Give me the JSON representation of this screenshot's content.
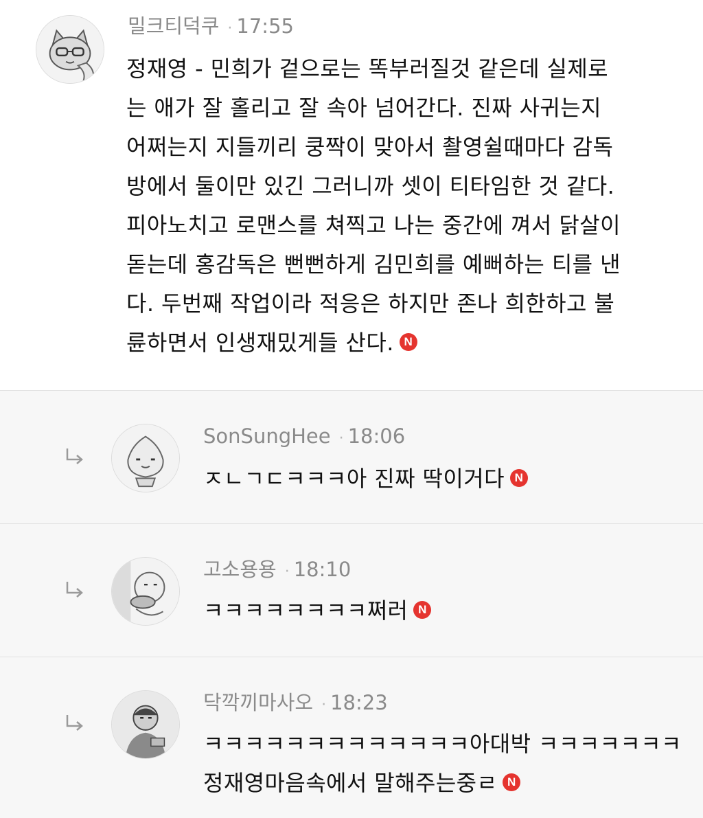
{
  "comments": [
    {
      "author": "밀크티덕쿠",
      "time": "17:55",
      "avatar_icon": "cat-character-avatar-icon",
      "lines": [
        "정재영 - 민희가 겉으로는 똑부러질것 같은데 실제로",
        "는 애가 잘 홀리고 잘 속아 넘어간다. 진짜 사귀는지",
        "어쩌는지 지들끼리 쿵짝이 맞아서 촬영쉴때마다 감독",
        "방에서 둘이만 있긴 그러니까 셋이 티타임한 것 같다.",
        "피아노치고 로맨스를 쳐찍고 나는 중간에 껴서 닭살이",
        "돋는데 홍감독은 뻔뻔하게 김민희를 예뻐하는 티를 낸",
        "다. 두번째 작업이라 적응은 하지만 존나 희한하고 불",
        "륜하면서 인생재밌게들 산다."
      ],
      "badge": "N"
    }
  ],
  "replies": [
    {
      "author": "SonSungHee",
      "time": "18:06",
      "avatar_icon": "peach-character-avatar-icon",
      "lines": [
        "ㅈㄴㄱㄷㅋㅋㅋ아 진짜 딱이거다"
      ],
      "badge": "N"
    },
    {
      "author": "고소용용",
      "time": "18:10",
      "avatar_icon": "eating-character-avatar-icon",
      "lines": [
        "ㅋㅋㅋㅋㅋㅋㅋㅋ쩌러"
      ],
      "badge": "N"
    },
    {
      "author": "닥깍끼마사오",
      "time": "18:23",
      "avatar_icon": "person-photo-avatar-icon",
      "lines": [
        "ㅋㅋㅋㅋㅋㅋㅋㅋㅋㅋㅋㅋㅋ아대박 ㅋㅋㅋㅋㅋㅋㅋ",
        "정재영마음속에서 말해주는중ㄹ"
      ],
      "badge": "N"
    }
  ],
  "colors": {
    "badge": "#e5342f",
    "meta_text": "#8a8a8a",
    "reply_bg": "#f7f7f7"
  }
}
